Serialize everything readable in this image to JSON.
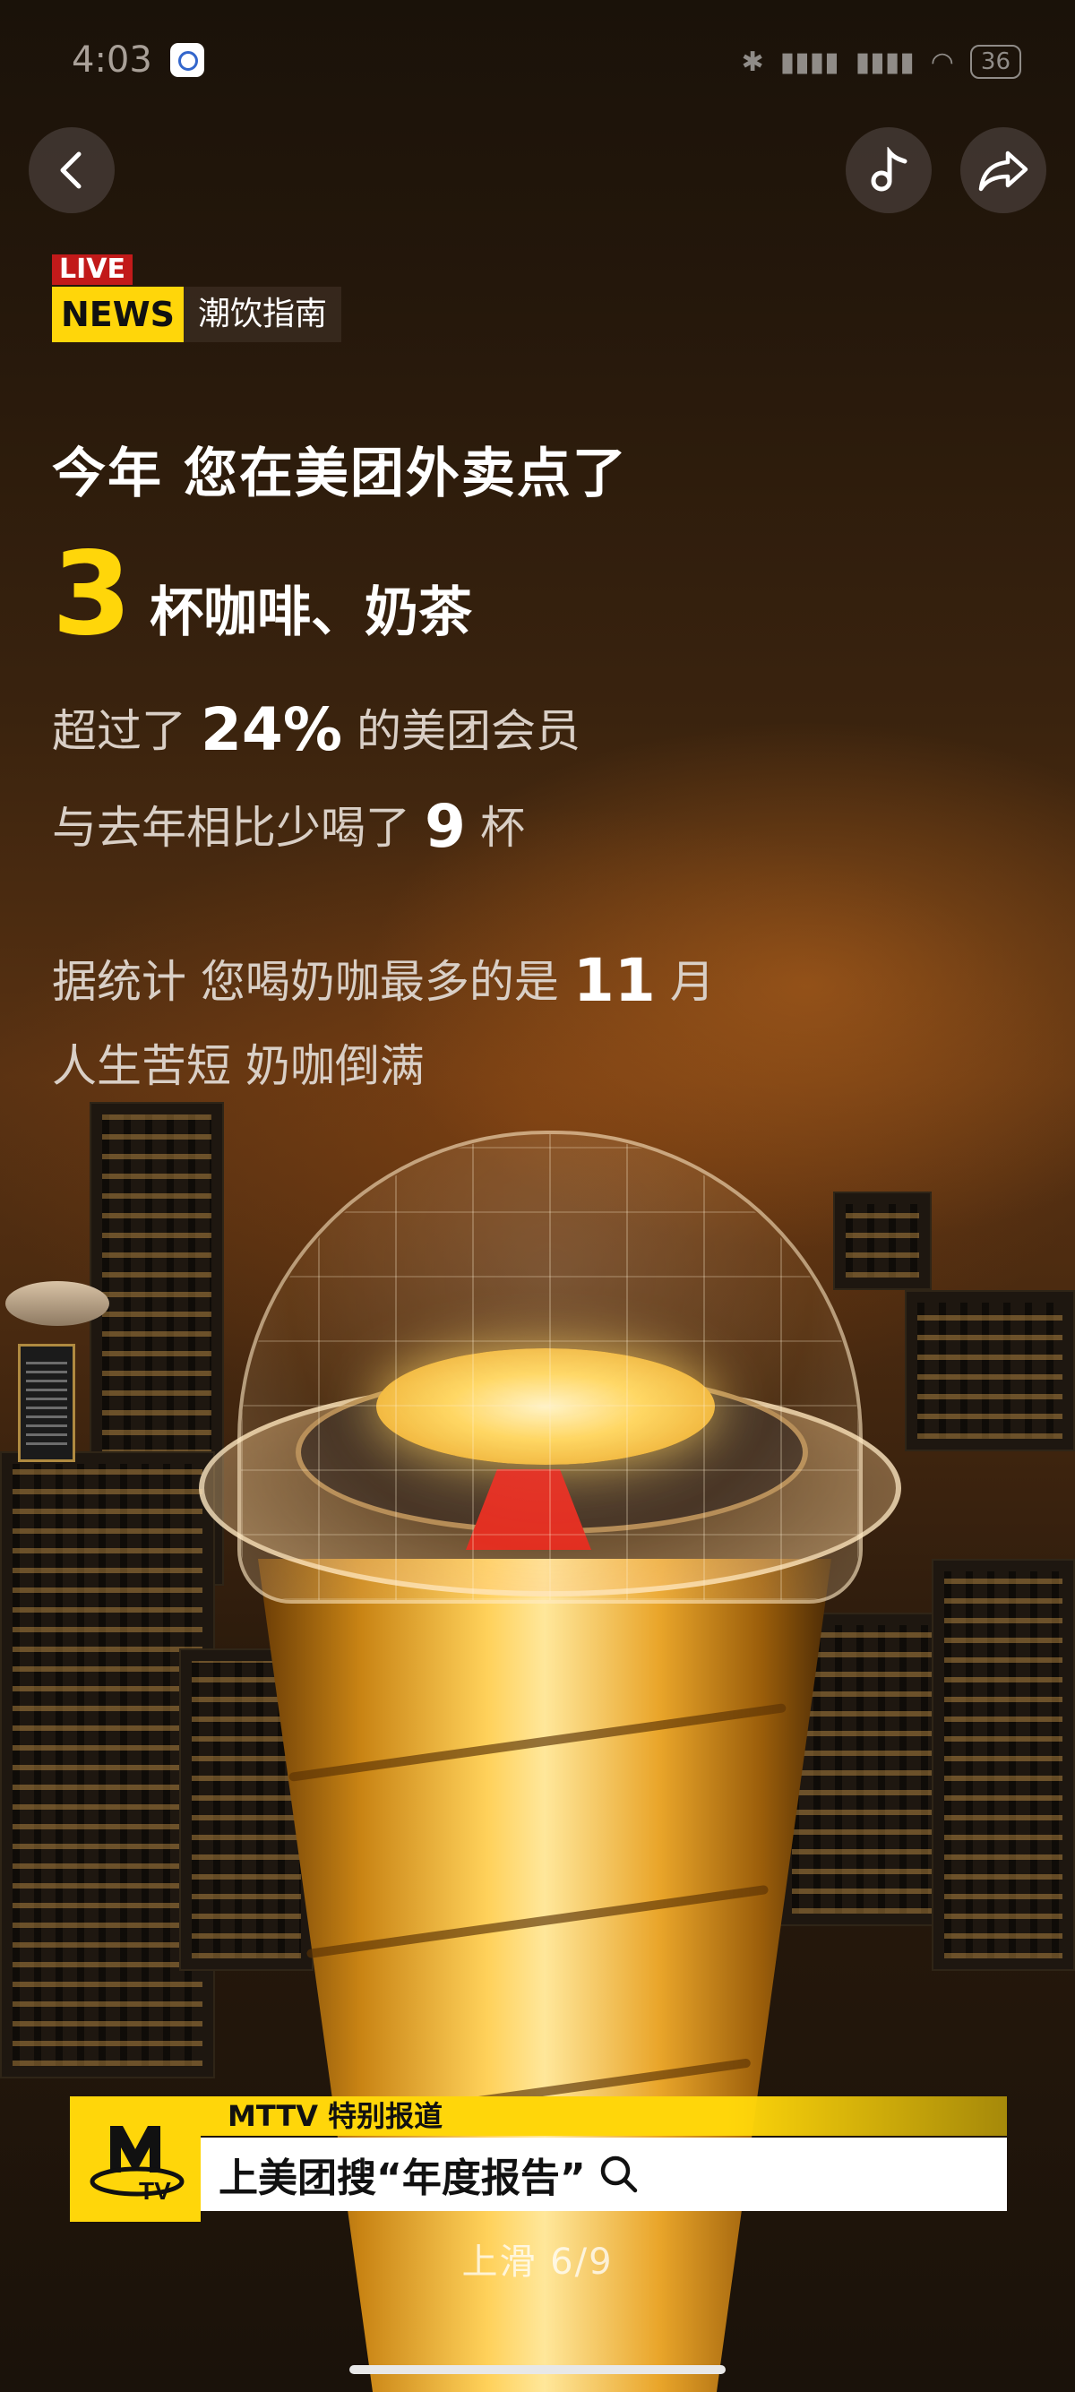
{
  "status_bar": {
    "time": "4:03",
    "battery": "36"
  },
  "header": {
    "live_tag": "LIVE",
    "news_tag": "NEWS",
    "channel_name": "潮饮指南"
  },
  "report": {
    "headline": "今年 您在美团外卖点了",
    "cups_count": "3",
    "cups_label": "杯咖啡、奶茶",
    "percentile_prefix": "超过了",
    "percentile_value": "24%",
    "percentile_suffix": "的美团会员",
    "compare_prefix": "与去年相比少喝了",
    "compare_value": "9",
    "compare_suffix": "杯",
    "month_prefix": "据统计 您喝奶咖最多的是",
    "month_value": "11",
    "month_suffix": "月",
    "slogan": "人生苦短 奶咖倒满"
  },
  "banner": {
    "title": "MTTV 特别报道",
    "search_text": "上美团搜“年度报告”",
    "logo_text": "TV"
  },
  "pager": {
    "hint": "上滑 6/9"
  },
  "icons": {
    "back": "chevron-left-icon",
    "music": "music-note-icon",
    "share": "share-icon",
    "search": "search-icon"
  },
  "colors": {
    "accent_yellow": "#ffd60a",
    "live_red": "#c21a1a"
  }
}
